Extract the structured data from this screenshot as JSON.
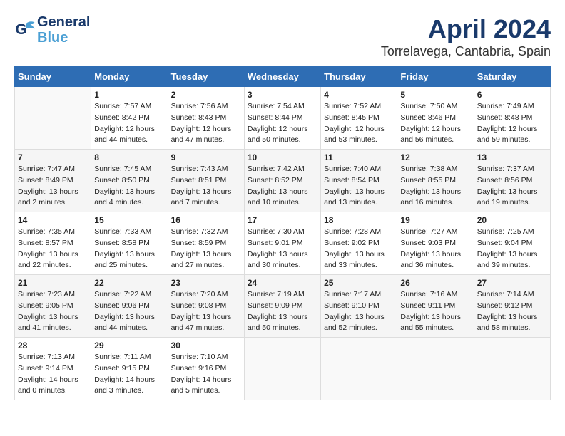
{
  "logo": {
    "line1": "General",
    "line2": "Blue"
  },
  "title": "April 2024",
  "subtitle": "Torrelavega, Cantabria, Spain",
  "days_header": [
    "Sunday",
    "Monday",
    "Tuesday",
    "Wednesday",
    "Thursday",
    "Friday",
    "Saturday"
  ],
  "weeks": [
    [
      {
        "day": "",
        "sunrise": "",
        "sunset": "",
        "daylight": ""
      },
      {
        "day": "1",
        "sunrise": "Sunrise: 7:57 AM",
        "sunset": "Sunset: 8:42 PM",
        "daylight": "Daylight: 12 hours and 44 minutes."
      },
      {
        "day": "2",
        "sunrise": "Sunrise: 7:56 AM",
        "sunset": "Sunset: 8:43 PM",
        "daylight": "Daylight: 12 hours and 47 minutes."
      },
      {
        "day": "3",
        "sunrise": "Sunrise: 7:54 AM",
        "sunset": "Sunset: 8:44 PM",
        "daylight": "Daylight: 12 hours and 50 minutes."
      },
      {
        "day": "4",
        "sunrise": "Sunrise: 7:52 AM",
        "sunset": "Sunset: 8:45 PM",
        "daylight": "Daylight: 12 hours and 53 minutes."
      },
      {
        "day": "5",
        "sunrise": "Sunrise: 7:50 AM",
        "sunset": "Sunset: 8:46 PM",
        "daylight": "Daylight: 12 hours and 56 minutes."
      },
      {
        "day": "6",
        "sunrise": "Sunrise: 7:49 AM",
        "sunset": "Sunset: 8:48 PM",
        "daylight": "Daylight: 12 hours and 59 minutes."
      }
    ],
    [
      {
        "day": "7",
        "sunrise": "Sunrise: 7:47 AM",
        "sunset": "Sunset: 8:49 PM",
        "daylight": "Daylight: 13 hours and 2 minutes."
      },
      {
        "day": "8",
        "sunrise": "Sunrise: 7:45 AM",
        "sunset": "Sunset: 8:50 PM",
        "daylight": "Daylight: 13 hours and 4 minutes."
      },
      {
        "day": "9",
        "sunrise": "Sunrise: 7:43 AM",
        "sunset": "Sunset: 8:51 PM",
        "daylight": "Daylight: 13 hours and 7 minutes."
      },
      {
        "day": "10",
        "sunrise": "Sunrise: 7:42 AM",
        "sunset": "Sunset: 8:52 PM",
        "daylight": "Daylight: 13 hours and 10 minutes."
      },
      {
        "day": "11",
        "sunrise": "Sunrise: 7:40 AM",
        "sunset": "Sunset: 8:54 PM",
        "daylight": "Daylight: 13 hours and 13 minutes."
      },
      {
        "day": "12",
        "sunrise": "Sunrise: 7:38 AM",
        "sunset": "Sunset: 8:55 PM",
        "daylight": "Daylight: 13 hours and 16 minutes."
      },
      {
        "day": "13",
        "sunrise": "Sunrise: 7:37 AM",
        "sunset": "Sunset: 8:56 PM",
        "daylight": "Daylight: 13 hours and 19 minutes."
      }
    ],
    [
      {
        "day": "14",
        "sunrise": "Sunrise: 7:35 AM",
        "sunset": "Sunset: 8:57 PM",
        "daylight": "Daylight: 13 hours and 22 minutes."
      },
      {
        "day": "15",
        "sunrise": "Sunrise: 7:33 AM",
        "sunset": "Sunset: 8:58 PM",
        "daylight": "Daylight: 13 hours and 25 minutes."
      },
      {
        "day": "16",
        "sunrise": "Sunrise: 7:32 AM",
        "sunset": "Sunset: 8:59 PM",
        "daylight": "Daylight: 13 hours and 27 minutes."
      },
      {
        "day": "17",
        "sunrise": "Sunrise: 7:30 AM",
        "sunset": "Sunset: 9:01 PM",
        "daylight": "Daylight: 13 hours and 30 minutes."
      },
      {
        "day": "18",
        "sunrise": "Sunrise: 7:28 AM",
        "sunset": "Sunset: 9:02 PM",
        "daylight": "Daylight: 13 hours and 33 minutes."
      },
      {
        "day": "19",
        "sunrise": "Sunrise: 7:27 AM",
        "sunset": "Sunset: 9:03 PM",
        "daylight": "Daylight: 13 hours and 36 minutes."
      },
      {
        "day": "20",
        "sunrise": "Sunrise: 7:25 AM",
        "sunset": "Sunset: 9:04 PM",
        "daylight": "Daylight: 13 hours and 39 minutes."
      }
    ],
    [
      {
        "day": "21",
        "sunrise": "Sunrise: 7:23 AM",
        "sunset": "Sunset: 9:05 PM",
        "daylight": "Daylight: 13 hours and 41 minutes."
      },
      {
        "day": "22",
        "sunrise": "Sunrise: 7:22 AM",
        "sunset": "Sunset: 9:06 PM",
        "daylight": "Daylight: 13 hours and 44 minutes."
      },
      {
        "day": "23",
        "sunrise": "Sunrise: 7:20 AM",
        "sunset": "Sunset: 9:08 PM",
        "daylight": "Daylight: 13 hours and 47 minutes."
      },
      {
        "day": "24",
        "sunrise": "Sunrise: 7:19 AM",
        "sunset": "Sunset: 9:09 PM",
        "daylight": "Daylight: 13 hours and 50 minutes."
      },
      {
        "day": "25",
        "sunrise": "Sunrise: 7:17 AM",
        "sunset": "Sunset: 9:10 PM",
        "daylight": "Daylight: 13 hours and 52 minutes."
      },
      {
        "day": "26",
        "sunrise": "Sunrise: 7:16 AM",
        "sunset": "Sunset: 9:11 PM",
        "daylight": "Daylight: 13 hours and 55 minutes."
      },
      {
        "day": "27",
        "sunrise": "Sunrise: 7:14 AM",
        "sunset": "Sunset: 9:12 PM",
        "daylight": "Daylight: 13 hours and 58 minutes."
      }
    ],
    [
      {
        "day": "28",
        "sunrise": "Sunrise: 7:13 AM",
        "sunset": "Sunset: 9:14 PM",
        "daylight": "Daylight: 14 hours and 0 minutes."
      },
      {
        "day": "29",
        "sunrise": "Sunrise: 7:11 AM",
        "sunset": "Sunset: 9:15 PM",
        "daylight": "Daylight: 14 hours and 3 minutes."
      },
      {
        "day": "30",
        "sunrise": "Sunrise: 7:10 AM",
        "sunset": "Sunset: 9:16 PM",
        "daylight": "Daylight: 14 hours and 5 minutes."
      },
      {
        "day": "",
        "sunrise": "",
        "sunset": "",
        "daylight": ""
      },
      {
        "day": "",
        "sunrise": "",
        "sunset": "",
        "daylight": ""
      },
      {
        "day": "",
        "sunrise": "",
        "sunset": "",
        "daylight": ""
      },
      {
        "day": "",
        "sunrise": "",
        "sunset": "",
        "daylight": ""
      }
    ]
  ]
}
